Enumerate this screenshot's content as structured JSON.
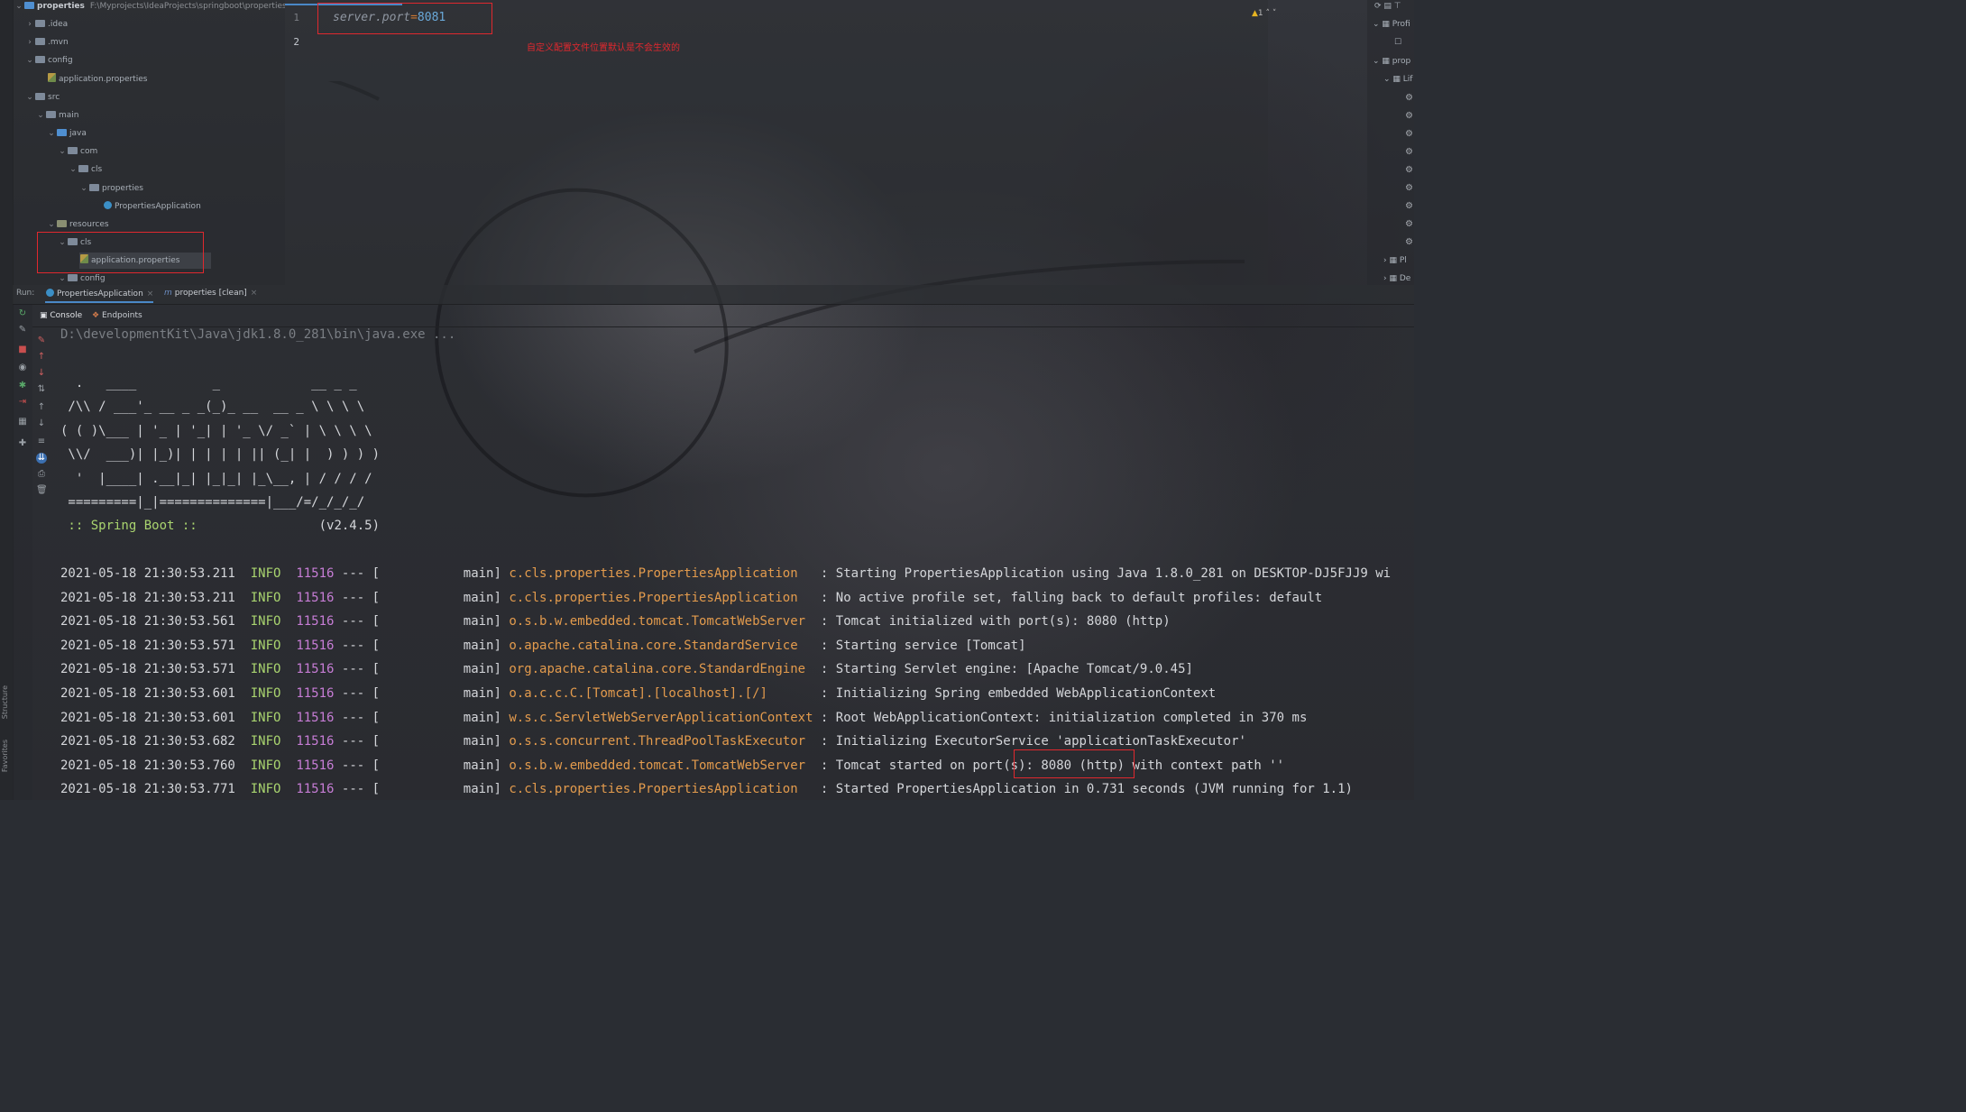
{
  "project_tree": {
    "root_name": "properties",
    "root_path": "F:\\Myprojects\\IdeaProjects\\springboot\\properties",
    "items": [
      {
        "label": ".idea"
      },
      {
        "label": ".mvn"
      },
      {
        "label": "config"
      },
      {
        "label": "application.properties"
      },
      {
        "label": "src"
      },
      {
        "label": "main"
      },
      {
        "label": "java"
      },
      {
        "label": "com"
      },
      {
        "label": "cls"
      },
      {
        "label": "properties"
      },
      {
        "label": "PropertiesApplication"
      },
      {
        "label": "resources"
      },
      {
        "label": "cls"
      },
      {
        "label": "application.properties"
      },
      {
        "label": "config"
      }
    ]
  },
  "editor": {
    "line_numbers": [
      "1",
      "2"
    ],
    "code_key": "server.port",
    "code_eq": "=",
    "code_val": "8081",
    "annotation": "自定义配置文件位置默认是不会生效的",
    "inspection_count": "1"
  },
  "right_panel": {
    "items": [
      "Profi",
      "prop",
      "Lif",
      "Pl",
      "De"
    ]
  },
  "run_panel": {
    "run_label": "Run:",
    "tabs": [
      {
        "label": "PropertiesApplication"
      },
      {
        "label": "properties [clean]"
      }
    ],
    "sub_tabs": [
      {
        "label": "Console"
      },
      {
        "label": "Endpoints"
      }
    ]
  },
  "left_stripe": {
    "structure": "Structure",
    "favorites": "Favorites"
  },
  "console": {
    "command": "D:\\developmentKit\\Java\\jdk1.8.0_281\\bin\\java.exe ...",
    "banner": [
      "  .   ____          _            __ _ _",
      " /\\\\ / ___'_ __ _ _(_)_ __  __ _ \\ \\ \\ \\",
      "( ( )\\___ | '_ | '_| | '_ \\/ _` | \\ \\ \\ \\",
      " \\\\/  ___)| |_)| | | | | || (_| |  ) ) ) )",
      "  '  |____| .__|_| |_|_| |_\\__, | / / / /",
      " =========|_|==============|___/=/_/_/_/"
    ],
    "spring_label": " :: Spring Boot :: ",
    "spring_version": "               (v2.4.5)",
    "logs": [
      {
        "ts": "2021-05-18 21:30:53.211",
        "level": "INFO",
        "pid": "11516",
        "sep": " --- [",
        "thread": "           main] ",
        "logger": "c.cls.properties.PropertiesApplication  ",
        "msg": " : Starting PropertiesApplication using Java 1.8.0_281 on DESKTOP-DJ5FJJ9 wi"
      },
      {
        "ts": "2021-05-18 21:30:53.211",
        "level": "INFO",
        "pid": "11516",
        "sep": " --- [",
        "thread": "           main] ",
        "logger": "c.cls.properties.PropertiesApplication  ",
        "msg": " : No active profile set, falling back to default profiles: default"
      },
      {
        "ts": "2021-05-18 21:30:53.561",
        "level": "INFO",
        "pid": "11516",
        "sep": " --- [",
        "thread": "           main] ",
        "logger": "o.s.b.w.embedded.tomcat.TomcatWebServer ",
        "msg": " : Tomcat initialized with port(s): 8080 (http)"
      },
      {
        "ts": "2021-05-18 21:30:53.571",
        "level": "INFO",
        "pid": "11516",
        "sep": " --- [",
        "thread": "           main] ",
        "logger": "o.apache.catalina.core.StandardService  ",
        "msg": " : Starting service [Tomcat]"
      },
      {
        "ts": "2021-05-18 21:30:53.571",
        "level": "INFO",
        "pid": "11516",
        "sep": " --- [",
        "thread": "           main] ",
        "logger": "org.apache.catalina.core.StandardEngine ",
        "msg": " : Starting Servlet engine: [Apache Tomcat/9.0.45]"
      },
      {
        "ts": "2021-05-18 21:30:53.601",
        "level": "INFO",
        "pid": "11516",
        "sep": " --- [",
        "thread": "           main] ",
        "logger": "o.a.c.c.C.[Tomcat].[localhost].[/]      ",
        "msg": " : Initializing Spring embedded WebApplicationContext"
      },
      {
        "ts": "2021-05-18 21:30:53.601",
        "level": "INFO",
        "pid": "11516",
        "sep": " --- [",
        "thread": "           main] ",
        "logger": "w.s.c.ServletWebServerApplicationContext",
        "msg": " : Root WebApplicationContext: initialization completed in 370 ms"
      },
      {
        "ts": "2021-05-18 21:30:53.682",
        "level": "INFO",
        "pid": "11516",
        "sep": " --- [",
        "thread": "           main] ",
        "logger": "o.s.s.concurrent.ThreadPoolTaskExecutor ",
        "msg": " : Initializing ExecutorService 'applicationTaskExecutor'"
      },
      {
        "ts": "2021-05-18 21:30:53.760",
        "level": "INFO",
        "pid": "11516",
        "sep": " --- [",
        "thread": "           main] ",
        "logger": "o.s.b.w.embedded.tomcat.TomcatWebServer ",
        "msg": " : Tomcat started on port(s): 8080 (http) with context path ''"
      },
      {
        "ts": "2021-05-18 21:30:53.771",
        "level": "INFO",
        "pid": "11516",
        "sep": " --- [",
        "thread": "           main] ",
        "logger": "c.cls.properties.PropertiesApplication  ",
        "msg": " : Started PropertiesApplication in 0.731 seconds (JVM running for 1.1)"
      }
    ]
  }
}
